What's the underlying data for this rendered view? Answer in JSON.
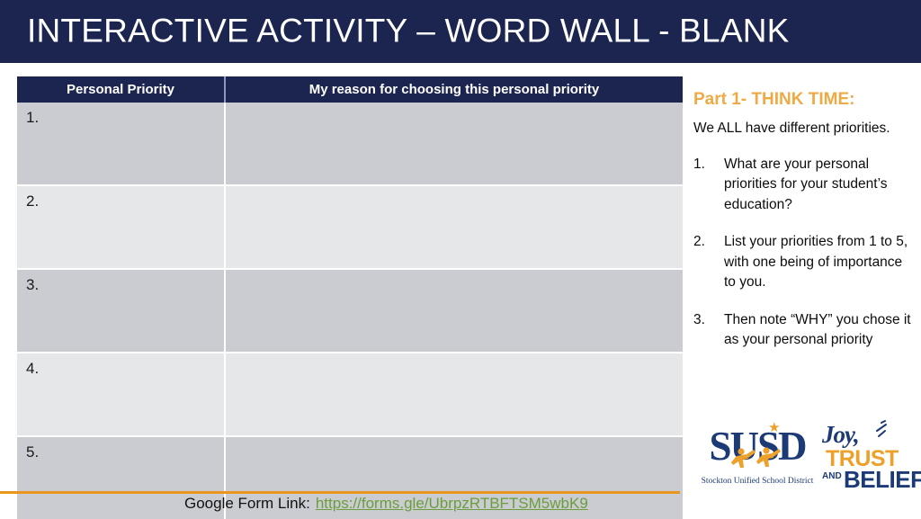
{
  "slide": {
    "title": "INTERACTIVE ACTIVITY – WORD WALL - BLANK"
  },
  "table": {
    "columns": [
      "Personal Priority",
      "My reason for choosing this personal priority"
    ],
    "rows": [
      {
        "priority": "1.",
        "reason": ""
      },
      {
        "priority": "2.",
        "reason": ""
      },
      {
        "priority": "3.",
        "reason": ""
      },
      {
        "priority": "4.",
        "reason": ""
      },
      {
        "priority": "5.",
        "reason": ""
      }
    ]
  },
  "instructions": {
    "heading": "Part 1- THINK TIME:",
    "intro": "We ALL have different priorities.",
    "items": [
      {
        "number": "1.",
        "text": "What are your personal priorities for your student’s education?"
      },
      {
        "number": "2.",
        "text": "List your priorities from 1 to 5, with one being of importance to you."
      },
      {
        "number": "3.",
        "text": "Then note “WHY” you chose it as your personal priority"
      }
    ]
  },
  "logos": {
    "susd": {
      "letters": "SUSD",
      "caption": "Stockton Unified School District"
    },
    "joy_trust_belief": {
      "joy": "Joy,",
      "trust": "TRUST",
      "and": "AND",
      "belief": "BELIEF"
    }
  },
  "footer": {
    "label": "Google Form Link:",
    "url": "https://forms.gle/UbrpzRTBFTSM5wbK9"
  },
  "colors": {
    "navy": "#1b2550",
    "orange": "#eeaa44",
    "link_green": "#6a9e3a",
    "rule_orange": "#e8961e",
    "row_dark": "#cbccd1",
    "row_light": "#e6e7e9"
  }
}
